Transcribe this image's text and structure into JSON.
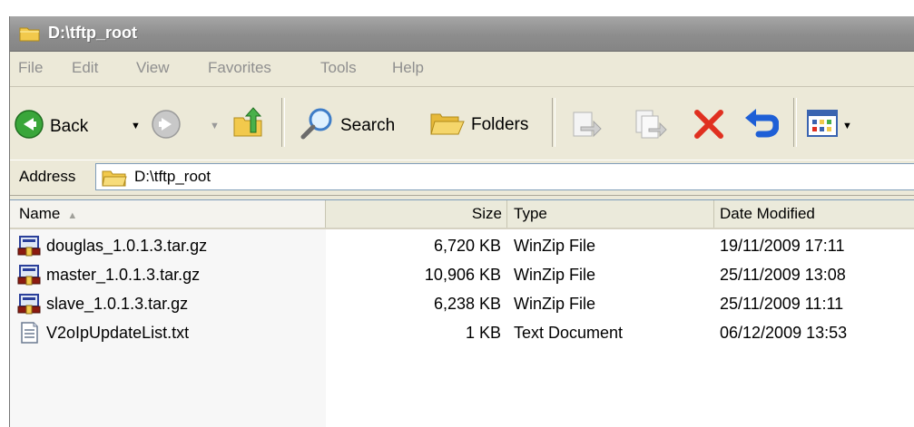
{
  "window": {
    "title": "D:\\tftp_root"
  },
  "menu": [
    "File",
    "Edit",
    "View",
    "Favorites",
    "Tools",
    "Help"
  ],
  "toolbar": {
    "back_label": "Back",
    "search_label": "Search",
    "folders_label": "Folders"
  },
  "address": {
    "label": "Address",
    "value": "D:\\tftp_root"
  },
  "columns": {
    "name": "Name",
    "size": "Size",
    "type": "Type",
    "date": "Date Modified"
  },
  "files": [
    {
      "icon": "winzip-icon",
      "name": "douglas_1.0.1.3.tar.gz",
      "size": "6,720 KB",
      "type": "WinZip File",
      "date": "19/11/2009 17:11"
    },
    {
      "icon": "winzip-icon",
      "name": "master_1.0.1.3.tar.gz",
      "size": "10,906 KB",
      "type": "WinZip File",
      "date": "25/11/2009 13:08"
    },
    {
      "icon": "winzip-icon",
      "name": "slave_1.0.1.3.tar.gz",
      "size": "6,238 KB",
      "type": "WinZip File",
      "date": "25/11/2009 11:11"
    },
    {
      "icon": "text-document-icon",
      "name": "V2oIpUpdateList.txt",
      "size": "1 KB",
      "type": "Text Document",
      "date": "06/12/2009 13:53"
    }
  ],
  "colors": {
    "titlebar_inactive": "#8d8d8d",
    "chrome": "#ece9d8",
    "back_green": "#2e9b2e",
    "delete_red": "#e03020",
    "undo_blue": "#1e5fd6"
  }
}
